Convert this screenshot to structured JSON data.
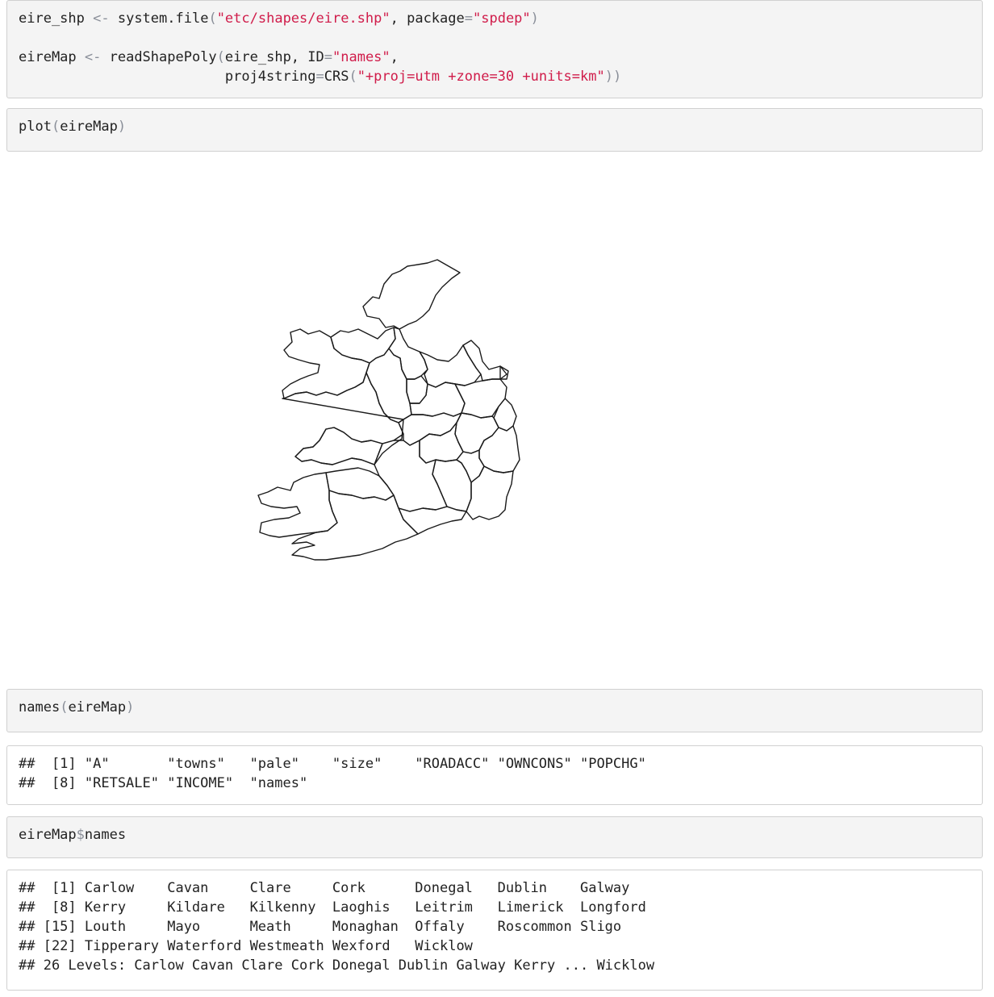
{
  "blocks": [
    {
      "id": "chunk-load",
      "kind": "code",
      "lines": [
        [
          {
            "t": "eire_shp ",
            "c": "pl"
          },
          {
            "t": "<-",
            "c": "op"
          },
          {
            "t": " system.file",
            "c": "pl"
          },
          {
            "t": "(",
            "c": "op"
          },
          {
            "t": "\"etc/shapes/eire.shp\"",
            "c": "str"
          },
          {
            "t": ", package",
            "c": "pl"
          },
          {
            "t": "=",
            "c": "op"
          },
          {
            "t": "\"spdep\"",
            "c": "str"
          },
          {
            "t": ")",
            "c": "op"
          }
        ],
        [],
        [
          {
            "t": "eireMap ",
            "c": "pl"
          },
          {
            "t": "<-",
            "c": "op"
          },
          {
            "t": " readShapePoly",
            "c": "pl"
          },
          {
            "t": "(",
            "c": "op"
          },
          {
            "t": "eire_shp, ID",
            "c": "pl"
          },
          {
            "t": "=",
            "c": "op"
          },
          {
            "t": "\"names\"",
            "c": "str"
          },
          {
            "t": ",",
            "c": "pl"
          }
        ],
        [
          {
            "t": "                         proj4string",
            "c": "pl"
          },
          {
            "t": "=",
            "c": "op"
          },
          {
            "t": "CRS",
            "c": "pl"
          },
          {
            "t": "(",
            "c": "op"
          },
          {
            "t": "\"+proj=utm +zone=30 +units=km\"",
            "c": "str"
          },
          {
            "t": "))",
            "c": "op"
          }
        ]
      ]
    },
    {
      "id": "chunk-plot",
      "kind": "code",
      "lines": [
        [
          {
            "t": "plot",
            "c": "pl"
          },
          {
            "t": "(",
            "c": "op"
          },
          {
            "t": "eireMap",
            "c": "pl"
          },
          {
            "t": ")",
            "c": "op"
          }
        ]
      ]
    },
    {
      "id": "chunk-names",
      "kind": "code",
      "lines": [
        [
          {
            "t": "names",
            "c": "pl"
          },
          {
            "t": "(",
            "c": "op"
          },
          {
            "t": "eireMap",
            "c": "pl"
          },
          {
            "t": ")",
            "c": "op"
          }
        ]
      ]
    },
    {
      "id": "output-names",
      "kind": "output",
      "lines": [
        [
          {
            "t": "##  [1] \"A\"       \"towns\"   \"pale\"    \"size\"    \"ROADACC\" \"OWNCONS\" \"POPCHG\"",
            "c": "pl"
          }
        ],
        [
          {
            "t": "##  [8] \"RETSALE\" \"INCOME\"  \"names\"",
            "c": "pl"
          }
        ]
      ]
    },
    {
      "id": "chunk-dollar",
      "kind": "code",
      "lines": [
        [
          {
            "t": "eireMap",
            "c": "pl"
          },
          {
            "t": "$",
            "c": "dlr"
          },
          {
            "t": "names",
            "c": "pl"
          }
        ]
      ]
    },
    {
      "id": "output-levels",
      "kind": "output",
      "lines": [
        [
          {
            "t": "##  [1] Carlow    Cavan     Clare     Cork      Donegal   Dublin    Galway",
            "c": "pl"
          }
        ],
        [
          {
            "t": "##  [8] Kerry     Kildare   Kilkenny  Laoghis   Leitrim   Limerick  Longford",
            "c": "pl"
          }
        ],
        [
          {
            "t": "## [15] Louth     Mayo      Meath     Monaghan  Offaly    Roscommon Sligo",
            "c": "pl"
          }
        ],
        [
          {
            "t": "## [22] Tipperary Waterford Westmeath Wexford   Wicklow",
            "c": "pl"
          }
        ],
        [
          {
            "t": "## 26 Levels: Carlow Cavan Clare Cork Donegal Dublin Galway Kerry ... Wicklow",
            "c": "pl"
          }
        ]
      ]
    }
  ],
  "colors": {
    "string": "#d01c4a",
    "operator": "#8a8f99",
    "code_background": "#f4f4f4",
    "border": "#d0d0d0",
    "map_stroke": "#1a1a1a"
  }
}
